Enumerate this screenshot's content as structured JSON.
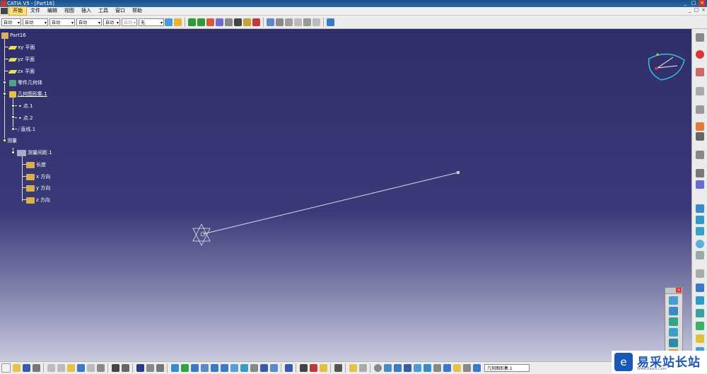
{
  "window": {
    "title": "CATIA V5 - [Part16]",
    "buttons": [
      "_",
      "□",
      "×"
    ]
  },
  "menu": {
    "items": [
      "开始",
      "文件",
      "编辑",
      "视图",
      "插入",
      "工具",
      "窗口",
      "帮助"
    ],
    "active_index": 0,
    "mdi_buttons": [
      "_",
      "□",
      "×"
    ]
  },
  "toolbar": {
    "combos": [
      {
        "value": "自动"
      },
      {
        "value": "自动"
      },
      {
        "value": "自动"
      },
      {
        "value": "自动"
      },
      {
        "value": "自动"
      },
      {
        "value": "自动"
      },
      {
        "value": "无"
      }
    ]
  },
  "tree": {
    "root": "Part16",
    "xy_plane": "xy 平面",
    "yz_plane": "yz 平面",
    "zx_plane": "zx 平面",
    "part_body": "零件几何体",
    "geo_set": "几何图形集.1",
    "point1": "点.1",
    "point2": "点.2",
    "line1": "直线.1",
    "measure": "测量",
    "measure_between": "测量间距.1",
    "length": "长度",
    "x_dir": "x 方向",
    "y_dir": "y 方向",
    "z_dir": "z 方向"
  },
  "status": {
    "current_body": "几何图形集.1"
  },
  "watermark": {
    "text": "易采站长站",
    "url": "Www.Easck.Com"
  },
  "colors": {
    "viewport_top": "#2f2e6a",
    "viewport_bottom": "#c9cbe0",
    "accent": "#ffe07a"
  }
}
